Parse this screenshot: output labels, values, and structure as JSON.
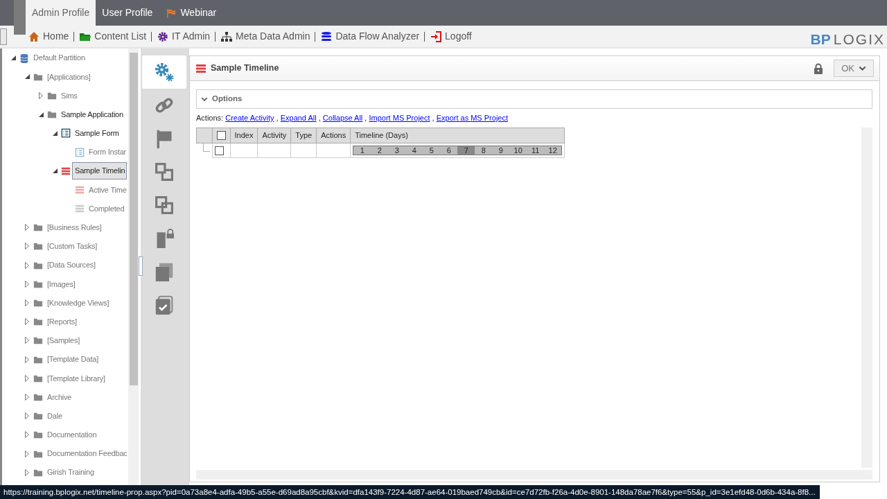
{
  "top_tabs": [
    {
      "label": "Admin Profile",
      "selected": true,
      "kind": "plain"
    },
    {
      "label": "User Profile",
      "selected": false,
      "kind": "plain"
    },
    {
      "label": "Webinar",
      "selected": false,
      "kind": "flag"
    }
  ],
  "nav": [
    {
      "label": "Home",
      "kind": "home"
    },
    {
      "label": "Content List",
      "kind": "folder"
    },
    {
      "label": "IT Admin",
      "kind": "gear"
    },
    {
      "label": "Meta Data Admin",
      "kind": "sitemap"
    },
    {
      "label": "Data Flow Analyzer",
      "kind": "database"
    },
    {
      "label": "Logoff",
      "kind": "exit"
    }
  ],
  "logo": {
    "brand": "BP",
    "name": "LOGIX"
  },
  "tree": [
    {
      "label": "Default Partition",
      "kind": "database",
      "expanded": true,
      "selected": false,
      "on_path": false,
      "children": [
        {
          "label": "[Applications]",
          "kind": "folder",
          "expanded": true,
          "selected": false,
          "on_path": false,
          "children": [
            {
              "label": "Sims",
              "kind": "folder",
              "expanded": false,
              "selected": false,
              "on_path": false
            },
            {
              "label": "Sample Application",
              "kind": "folder",
              "expanded": true,
              "selected": false,
              "on_path": true,
              "children": [
                {
                  "label": "Sample Form",
                  "kind": "form",
                  "expanded": true,
                  "selected": false,
                  "on_path": true,
                  "children": [
                    {
                      "label": "Form Instar",
                      "kind": "form-instance",
                      "selected": false,
                      "on_path": false
                    }
                  ]
                },
                {
                  "label": "Sample Timelin",
                  "kind": "timeline",
                  "expanded": true,
                  "selected": true,
                  "on_path": true,
                  "children": [
                    {
                      "label": "Active Time",
                      "kind": "timeline-active",
                      "selected": false,
                      "on_path": false
                    },
                    {
                      "label": "Completed",
                      "kind": "timeline-completed",
                      "selected": false,
                      "on_path": false
                    }
                  ]
                }
              ]
            }
          ]
        },
        {
          "label": "[Business Rules]",
          "kind": "folder",
          "expanded": false,
          "selected": false,
          "on_path": false
        },
        {
          "label": "[Custom Tasks]",
          "kind": "folder",
          "expanded": false,
          "selected": false,
          "on_path": false
        },
        {
          "label": "[Data Sources]",
          "kind": "folder",
          "expanded": false,
          "selected": false,
          "on_path": false
        },
        {
          "label": "[Images]",
          "kind": "folder",
          "expanded": false,
          "selected": false,
          "on_path": false
        },
        {
          "label": "[Knowledge Views]",
          "kind": "folder",
          "expanded": false,
          "selected": false,
          "on_path": false
        },
        {
          "label": "[Reports]",
          "kind": "folder",
          "expanded": false,
          "selected": false,
          "on_path": false
        },
        {
          "label": "[Samples]",
          "kind": "folder",
          "expanded": false,
          "selected": false,
          "on_path": false
        },
        {
          "label": "[Template Data]",
          "kind": "folder",
          "expanded": false,
          "selected": false,
          "on_path": false
        },
        {
          "label": "[Template Library]",
          "kind": "folder",
          "expanded": false,
          "selected": false,
          "on_path": false
        },
        {
          "label": "Archive",
          "kind": "folder",
          "expanded": false,
          "selected": false,
          "on_path": false
        },
        {
          "label": "Dale",
          "kind": "folder",
          "expanded": false,
          "selected": false,
          "on_path": false
        },
        {
          "label": "Documentation",
          "kind": "folder",
          "expanded": false,
          "selected": false,
          "on_path": false
        },
        {
          "label": "Documentation Feedbac",
          "kind": "folder",
          "expanded": false,
          "selected": false,
          "on_path": false
        },
        {
          "label": "Girish Training",
          "kind": "folder",
          "expanded": false,
          "selected": false,
          "on_path": false
        }
      ]
    }
  ],
  "side_tabs": [
    {
      "kind": "gears",
      "selected": true
    },
    {
      "kind": "link",
      "selected": false
    },
    {
      "kind": "flag",
      "selected": false
    },
    {
      "kind": "squares",
      "selected": false
    },
    {
      "kind": "overlap",
      "selected": false
    },
    {
      "kind": "doc-lock",
      "selected": false
    },
    {
      "kind": "pages",
      "selected": false
    },
    {
      "kind": "check-page",
      "selected": false
    }
  ],
  "panel": {
    "title": "Sample Timeline",
    "ok_button": "OK",
    "options": {
      "label": "Options",
      "expanded": false
    },
    "actions_label": "Actions:",
    "actions_separator": ",",
    "actions": [
      "Create Activity",
      "Expand All",
      "Collapse All",
      "Import MS Project",
      "Export as MS Project"
    ],
    "table": {
      "columns": [
        "Index",
        "Activity",
        "Type",
        "Actions",
        "Timeline (Days)"
      ],
      "header_checked": false,
      "rows": [
        {
          "checked": false,
          "days": [
            {
              "label": "1",
              "today": false
            },
            {
              "label": "2",
              "today": false
            },
            {
              "label": "3",
              "today": false
            },
            {
              "label": "4",
              "today": false
            },
            {
              "label": "5",
              "today": false
            },
            {
              "label": "6",
              "today": false
            },
            {
              "label": "7",
              "today": true
            },
            {
              "label": "8",
              "today": false
            },
            {
              "label": "9",
              "today": false
            },
            {
              "label": "10",
              "today": false
            },
            {
              "label": "11",
              "today": false
            },
            {
              "label": "12",
              "today": false
            }
          ]
        }
      ]
    }
  },
  "status_bar": "https://training.bplogix.net/timeline-prop.aspx?pid=0a73a8e4-adfa-49b5-a55e-d69ad8a95cbf&kvid=dfa143f9-7224-4d87-ae64-019baed749cb&id=ce7d72fb-f26a-4d0e-8901-148da78ae7f6&type=55&p_id=3e1efd48-0d6b-434a-8f8..."
}
